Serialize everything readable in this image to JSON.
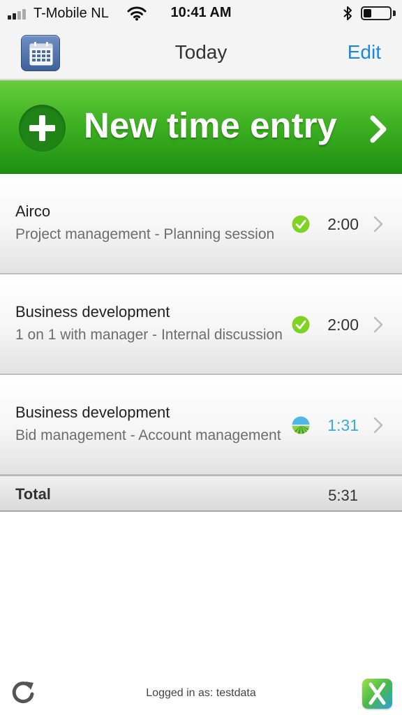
{
  "status_bar": {
    "carrier": "T-Mobile NL",
    "time": "10:41 AM",
    "battery_level": 0.3
  },
  "nav": {
    "title": "Today",
    "edit_label": "Edit",
    "left_icon": "calendar-icon"
  },
  "new_entry": {
    "label": "New time entry",
    "icon": "plus-circle-icon",
    "chevron": "chevron-right-icon",
    "color": "#3fb223"
  },
  "entries": [
    {
      "title": "Airco",
      "subtitle": "Project management - Planning session",
      "status": "approved",
      "duration": "2:00"
    },
    {
      "title": "Business development",
      "subtitle": "1 on 1 with manager - Internal discussion",
      "status": "approved",
      "duration": "2:00"
    },
    {
      "title": "Business development",
      "subtitle": "Bid management - Account management",
      "status": "running",
      "duration": "1:31"
    }
  ],
  "total": {
    "label": "Total",
    "value": "5:31"
  },
  "footer": {
    "logged_in": "Logged in as: testdata",
    "refresh_icon": "refresh-icon",
    "logo_icon": "app-logo-icon"
  },
  "colors": {
    "accent": "#1e88e0",
    "approved": "#7ed321",
    "running": "#33aee0"
  }
}
